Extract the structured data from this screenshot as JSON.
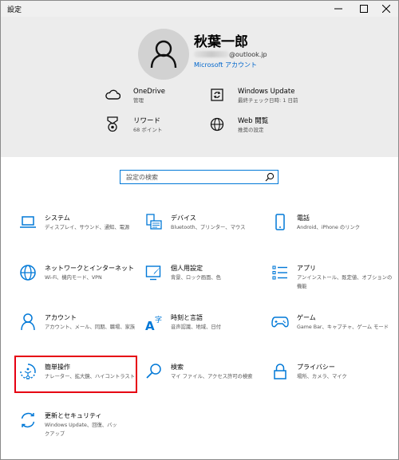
{
  "window": {
    "title": "設定"
  },
  "header": {
    "user_name": "秋葉一郎",
    "email_domain": "@outlook.jp",
    "account_type": "Microsoft アカウント",
    "items": [
      {
        "title": "OneDrive",
        "subtitle": "管理",
        "icon": "cloud-icon"
      },
      {
        "title": "Windows Update",
        "subtitle": "最終チェック日時: 1 日前",
        "icon": "windows-update-icon"
      },
      {
        "title": "リワード",
        "subtitle": "68 ポイント",
        "icon": "medal-icon"
      },
      {
        "title": "Web 閲覧",
        "subtitle": "推奨の設定",
        "icon": "globe-icon"
      }
    ]
  },
  "search": {
    "placeholder": "設定の検索"
  },
  "categories": [
    {
      "title": "システム",
      "subtitle": "ディスプレイ、サウンド、通知、電源",
      "icon": "laptop-icon"
    },
    {
      "title": "デバイス",
      "subtitle": "Bluetooth、プリンター、マウス",
      "icon": "devices-icon"
    },
    {
      "title": "電話",
      "subtitle": "Android、iPhone のリンク",
      "icon": "phone-icon"
    },
    {
      "title": "ネットワークとインターネット",
      "subtitle": "Wi-Fi、機内モード、VPN",
      "icon": "network-globe-icon"
    },
    {
      "title": "個人用設定",
      "subtitle": "背景、ロック画面、色",
      "icon": "personalization-icon"
    },
    {
      "title": "アプリ",
      "subtitle": "アンインストール、既定値、オプションの機能",
      "icon": "apps-list-icon"
    },
    {
      "title": "アカウント",
      "subtitle": "アカウント、メール、同期、職場、家族",
      "icon": "person-icon"
    },
    {
      "title": "時刻と言語",
      "subtitle": "音声認識、地域、日付",
      "icon": "time-language-icon"
    },
    {
      "title": "ゲーム",
      "subtitle": "Game Bar、キャプチャ、ゲーム モード",
      "icon": "gamepad-icon"
    },
    {
      "title": "簡単操作",
      "subtitle": "ナレーター、拡大鏡、ハイコントラスト",
      "icon": "ease-of-access-icon"
    },
    {
      "title": "検索",
      "subtitle": "マイ ファイル、アクセス許可の検索",
      "icon": "search-icon"
    },
    {
      "title": "プライバシー",
      "subtitle": "場所、カメラ、マイク",
      "icon": "lock-icon"
    },
    {
      "title": "更新とセキュリティ",
      "subtitle": "Windows Update、回復、バックアップ",
      "icon": "sync-icon"
    }
  ],
  "colors": {
    "accent": "#0078d7",
    "highlight": "#e60012",
    "header_bg": "#ececec"
  }
}
